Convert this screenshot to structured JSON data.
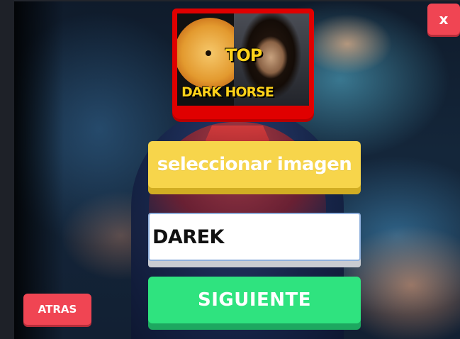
{
  "dialog": {
    "close_label": "x",
    "cover": {
      "top_text": "TOP",
      "title_text": "DARK HORSE"
    },
    "select_image_label": "seleccionar imagen",
    "name_input": {
      "value": "DAREK",
      "placeholder": ""
    },
    "next_label": "SIGUIENTE",
    "back_label": "ATRAS"
  },
  "colors": {
    "close": "#f04553",
    "select_image": "#f7d54b",
    "next": "#2fe37f",
    "back": "#f04553",
    "cover_border": "#e00000"
  }
}
